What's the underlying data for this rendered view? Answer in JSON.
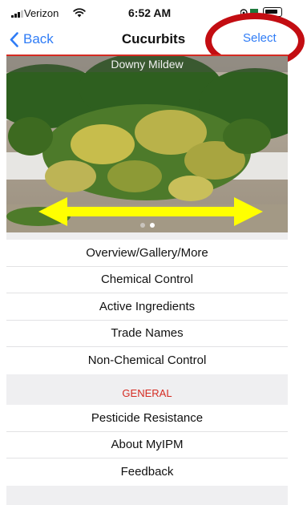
{
  "status_bar": {
    "carrier": "Verizon",
    "time": "6:52 AM"
  },
  "nav": {
    "back_label": "Back",
    "title": "Cucurbits",
    "select_label": "Select"
  },
  "hero": {
    "caption": "Downy Mildew",
    "page_count": 2,
    "current_page": 2
  },
  "menu": {
    "items": [
      {
        "label": "Overview/Gallery/More"
      },
      {
        "label": "Chemical Control"
      },
      {
        "label": "Active Ingredients"
      },
      {
        "label": "Trade Names"
      },
      {
        "label": "Non-Chemical Control"
      }
    ]
  },
  "general": {
    "header": "GENERAL",
    "items": [
      {
        "label": "Pesticide Resistance"
      },
      {
        "label": "About MyIPM"
      },
      {
        "label": "Feedback"
      }
    ]
  },
  "colors": {
    "accent_blue": "#2f7cf6",
    "section_red": "#d52b22",
    "annotation_red": "#c30d12",
    "arrow_yellow": "#ffff00"
  }
}
